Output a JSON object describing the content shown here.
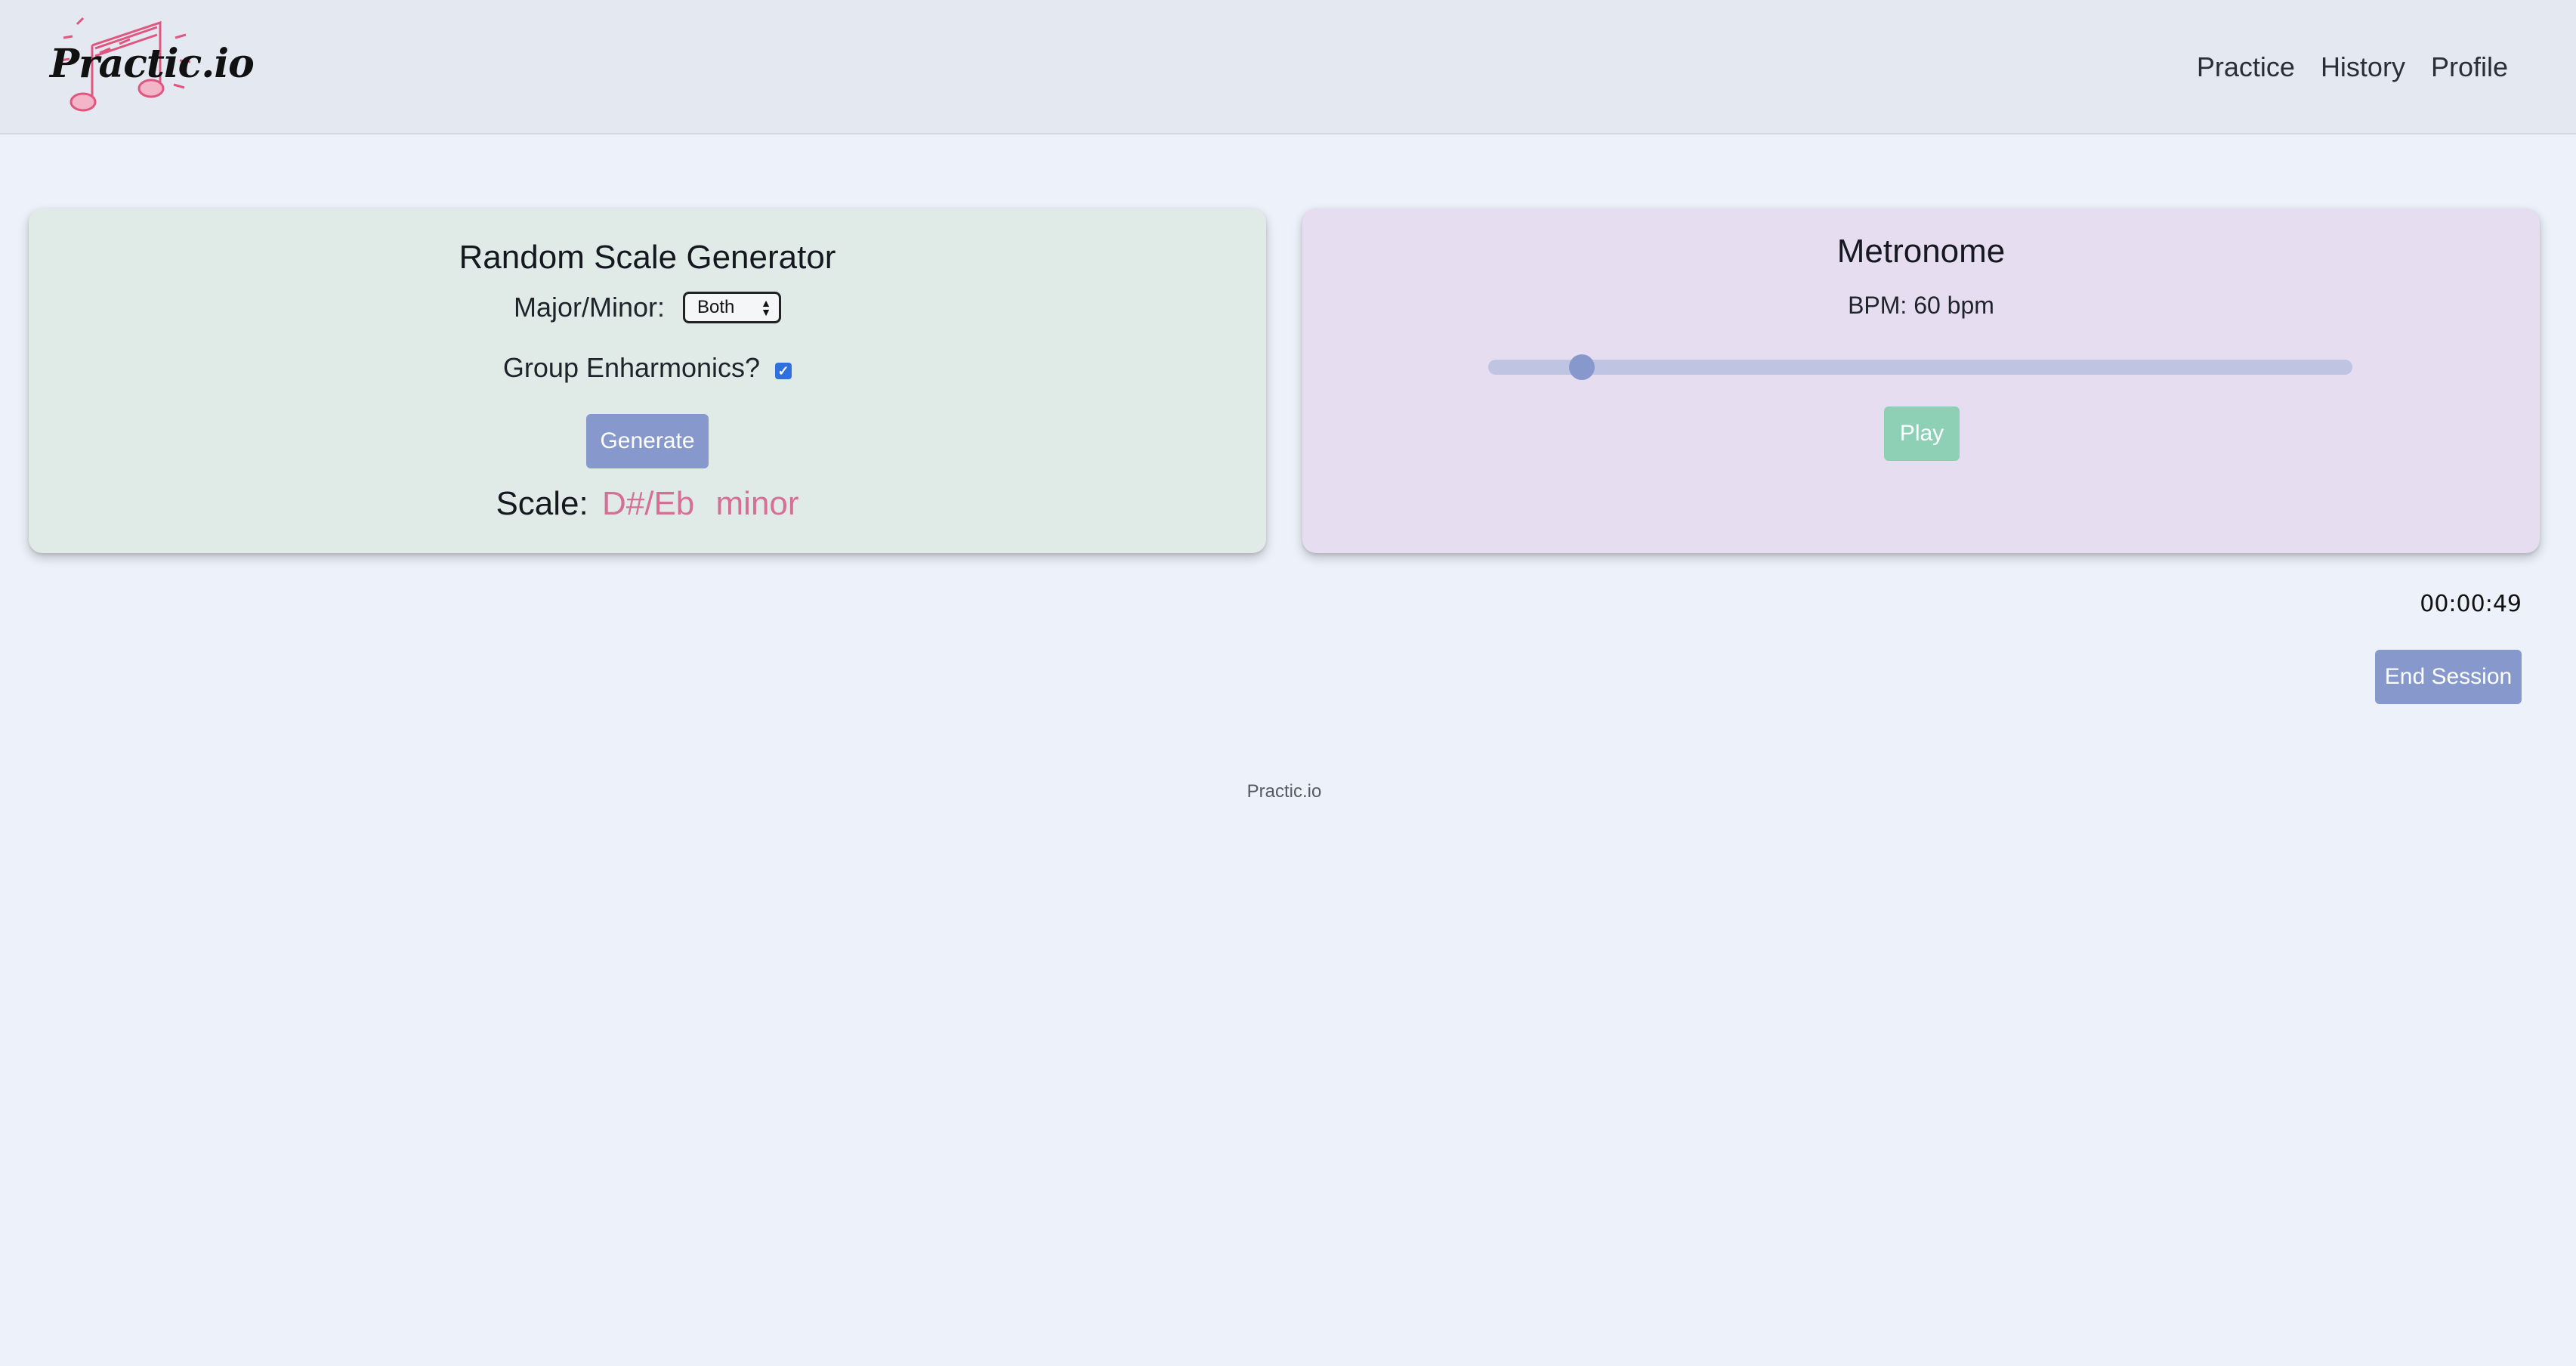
{
  "header": {
    "logo_text": "Practic.io",
    "nav": [
      {
        "label": "Practice"
      },
      {
        "label": "History"
      },
      {
        "label": "Profile"
      }
    ]
  },
  "scale_generator": {
    "title": "Random Scale Generator",
    "major_minor_label": "Major/Minor:",
    "major_minor_selected": "Both",
    "enharmonics_label": "Group Enharmonics?",
    "enharmonics_checked": true,
    "generate_label": "Generate",
    "scale_label": "Scale:",
    "scale_value": "D#/Eb",
    "scale_mode": "minor"
  },
  "metronome": {
    "title": "Metronome",
    "bpm_text": "BPM: 60 bpm",
    "bpm_value": 60,
    "bpm_min": 40,
    "bpm_max": 250,
    "play_label": "Play"
  },
  "session": {
    "timer": "00:00:49",
    "end_label": "End Session"
  },
  "footer": {
    "text": "Practic.io"
  },
  "colors": {
    "accent": "#8799cc",
    "scale_highlight": "#d56f95",
    "play_button": "#8ed0b5",
    "scale_card_bg": "#e0ebe8",
    "metronome_card_bg": "#e6ddf1"
  }
}
